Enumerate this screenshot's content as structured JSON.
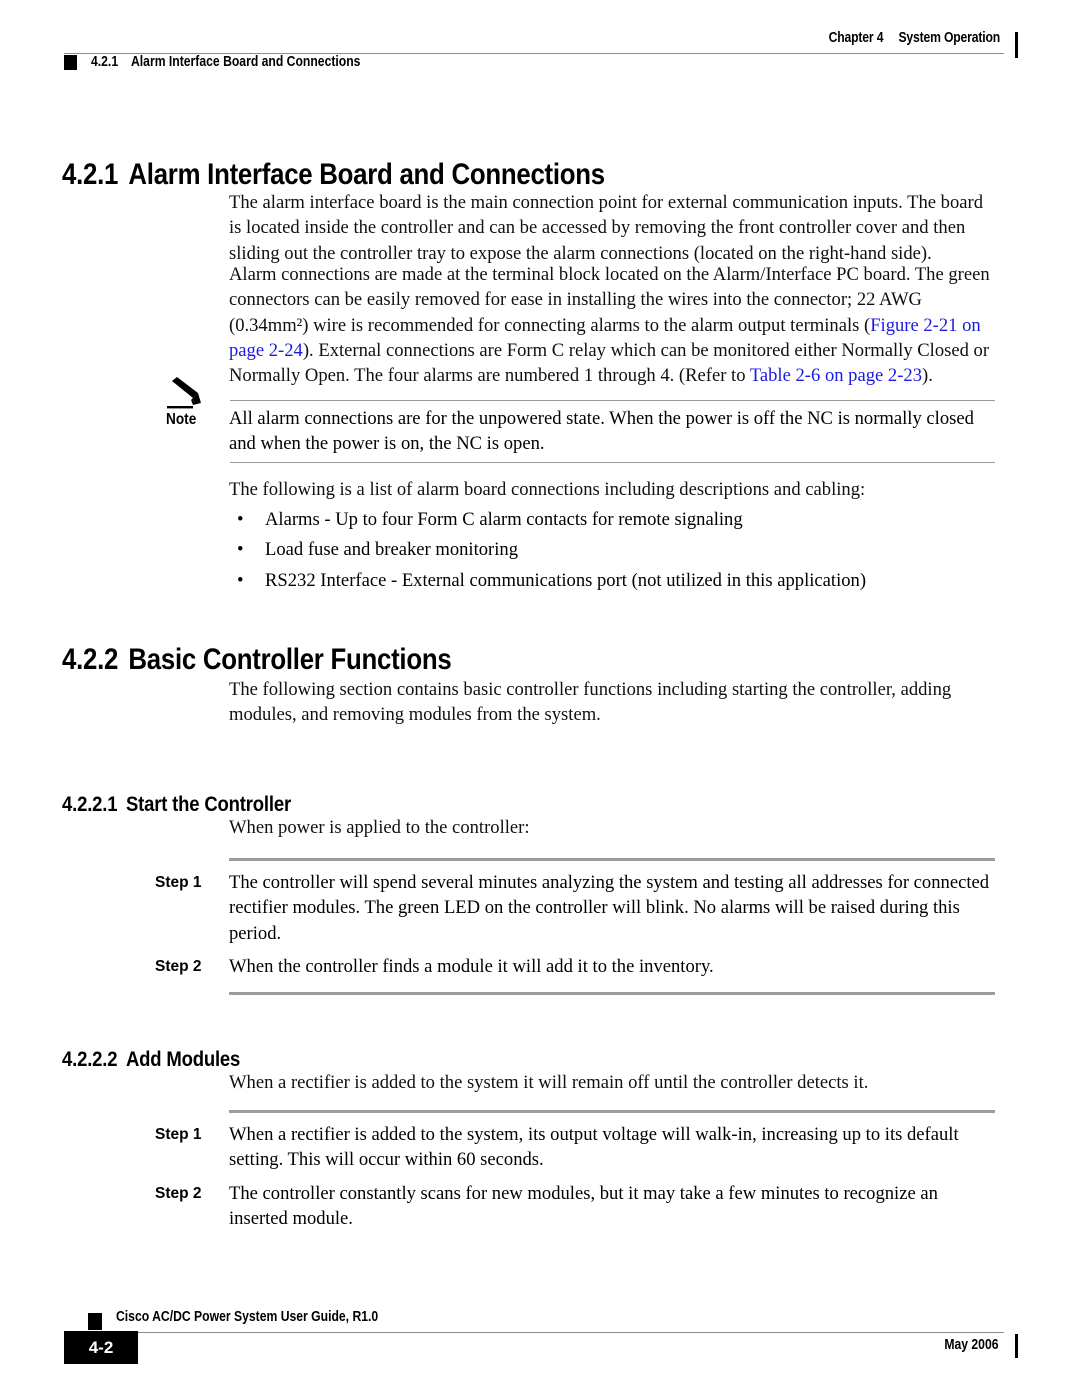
{
  "header": {
    "chapter": "Chapter 4",
    "chapter_title": "System Operation",
    "section_number": "4.2.1",
    "section_title": "Alarm Interface Board and Connections"
  },
  "headings": {
    "h421_num": "4.2.1",
    "h421_title": "Alarm Interface Board and Connections",
    "h422_num": "4.2.2",
    "h422_title": "Basic Controller Functions",
    "h4221_num": "4.2.2.1",
    "h4221_title": "Start the Controller",
    "h4222_num": "4.2.2.2",
    "h4222_title": "Add Modules"
  },
  "paragraphs": {
    "p1": "The alarm interface board is the main connection point for external communication inputs. The board is located inside the controller and can be accessed by removing the front controller cover and then sliding out the controller tray to expose the alarm connections (located on the right-hand side).",
    "p2_part1": "Alarm connections are made at the terminal block located on the Alarm/Interface PC board. The green connectors can be easily removed for ease in installing the wires into the connector; 22 AWG (0.34mm²) wire is recommended for connecting alarms to the alarm output terminals (",
    "p2_link1": "Figure 2-21 on page 2-24",
    "p2_part2": "). External connections are Form C relay which can be monitored either Normally Closed or Normally Open. The four alarms are numbered 1 through 4. (Refer to ",
    "p2_link2": "Table 2-6 on page 2-23",
    "p2_part3": ").",
    "p3": "The following is a list of alarm board connections including descriptions and cabling:",
    "p4": "The following section contains basic controller functions including starting the controller, adding modules, and removing modules from the system.",
    "p5": "When power is applied to the controller:",
    "p6": "When a rectifier is added to the system it will remain off until the controller detects it."
  },
  "note": {
    "icon": "pencil-icon",
    "label": "Note",
    "text": "All alarm connections are for the unpowered state. When the power is off the NC is normally closed and when the power is on, the NC is open."
  },
  "bullets": {
    "marker": "•",
    "items": [
      "Alarms - Up to four Form C alarm contacts for remote signaling",
      "Load fuse and breaker monitoring",
      "RS232 Interface - External communications port (not utilized in this application)"
    ]
  },
  "steps_start_controller": [
    {
      "label": "Step 1",
      "text": "The controller will spend several minutes analyzing the system and testing all addresses for connected rectifier modules. The green LED on the controller will blink. No alarms will be raised during this period."
    },
    {
      "label": "Step 2",
      "text": "When the controller finds a module it will add it to the inventory."
    }
  ],
  "steps_add_modules": [
    {
      "label": "Step 1",
      "text": "When a rectifier is added to the system, its output voltage will walk-in, increasing up to its default setting. This will occur within 60 seconds."
    },
    {
      "label": "Step 2",
      "text": "The controller constantly scans for new modules, but it may take a few minutes to recognize an inserted module."
    }
  ],
  "footer": {
    "guide_title": "Cisco AC/DC Power System User Guide, R1.0",
    "page_number": "4-2",
    "date": "May 2006"
  },
  "colors": {
    "link": "#1a1ae0",
    "rule": "#8c8c8c",
    "step_rule": "#9c9c9c",
    "text": "#000000"
  }
}
